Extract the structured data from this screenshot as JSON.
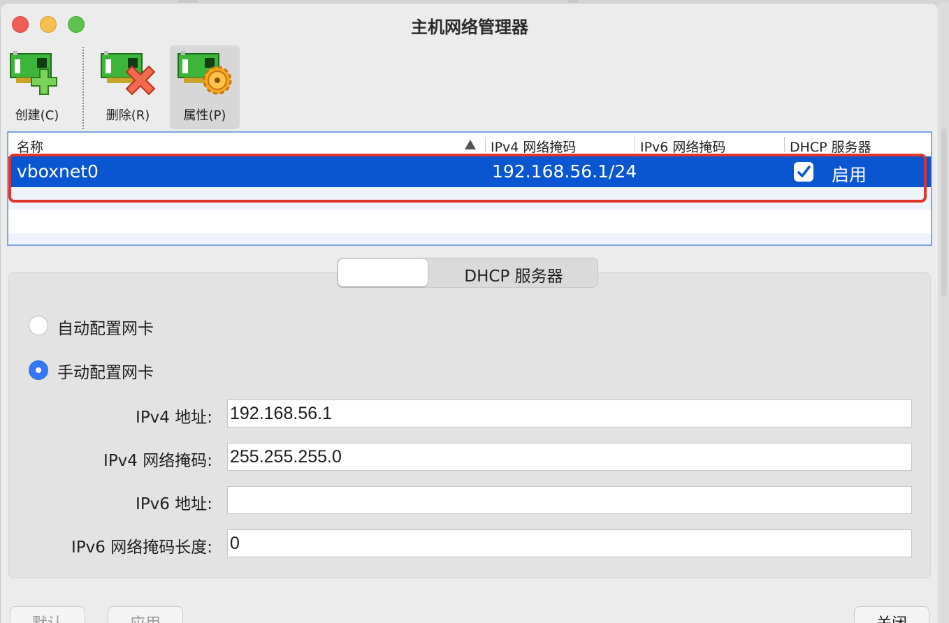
{
  "window": {
    "title": "主机网络管理器"
  },
  "toolbar": {
    "create_label": "创建(C)",
    "delete_label": "删除(R)",
    "properties_label": "属性(P)"
  },
  "table": {
    "columns": [
      "名称",
      "IPv4 网络掩码",
      "IPv6 网络掩码",
      "DHCP 服务器"
    ],
    "rows": [
      {
        "name": "vboxnet0",
        "ipv4_mask": "192.168.56.1/24",
        "ipv6_mask": "",
        "dhcp_checked": true,
        "dhcp_label": "启用"
      }
    ]
  },
  "tabs": {
    "adapter_label": "",
    "dhcp_label": "DHCP 服务器"
  },
  "config": {
    "auto_label": "自动配置网卡",
    "manual_label": "手动配置网卡",
    "selected": "manual"
  },
  "fields": {
    "ipv4_addr_label": "IPv4 地址:",
    "ipv4_addr_value": "192.168.56.1",
    "ipv4_mask_label": "IPv4 网络掩码:",
    "ipv4_mask_value": "255.255.255.0",
    "ipv6_addr_label": "IPv6 地址:",
    "ipv6_addr_value": "",
    "ipv6_len_label": "IPv6 网络掩码长度:",
    "ipv6_len_value": "0"
  },
  "buttons": {
    "reset_label": "默认",
    "apply_label": "应用",
    "close_label": "关闭"
  },
  "colors": {
    "selection": "#0a55d0",
    "highlight_box": "#e3342c",
    "radio_on": "#3478f6"
  }
}
